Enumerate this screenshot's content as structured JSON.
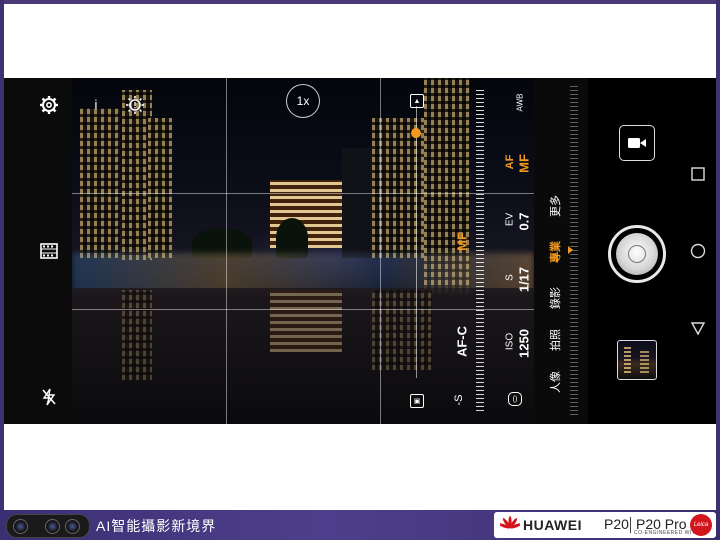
{
  "colors": {
    "accent": "#f39a1e",
    "banner": "#4a3c86",
    "brand_red": "#d3161c"
  },
  "left_bar": {
    "icons": [
      "gear-icon",
      "info-icon",
      "light-painting-icon",
      "film-icon",
      "flash-off-icon"
    ],
    "info_label": "i"
  },
  "viewfinder": {
    "zoom_label": "1x"
  },
  "pro_params": {
    "awb_label": "AWB",
    "af_label": "AF",
    "mf_label": "MF",
    "ev_label": "EV",
    "ev_value": "0.7",
    "s_label": "S",
    "s_value": "1/17",
    "iso_label": "ISO",
    "iso_value": "1250",
    "focus_mode_value": "AF-C",
    "focus_side_value": "MF",
    "more_label": "更多",
    "meter_icon": "metering-icon",
    "focus_level": 0.1
  },
  "modes": {
    "items": [
      "人像",
      "拍照",
      "錄影",
      "專業",
      "更多"
    ],
    "active": "專業"
  },
  "controls": {
    "video_icon": "video-camera-icon",
    "shutter": "shutter-button",
    "gallery": "gallery-thumbnail"
  },
  "nav": [
    "recent-apps-icon",
    "home-icon",
    "back-icon"
  ],
  "banner": {
    "text": "AI智能攝影新境界",
    "brand": "HUAWEI",
    "model": "P20",
    "model_pro": "P20 Pro",
    "co_engineered": "CO-ENGINEERED WITH",
    "leica": "Leica"
  }
}
